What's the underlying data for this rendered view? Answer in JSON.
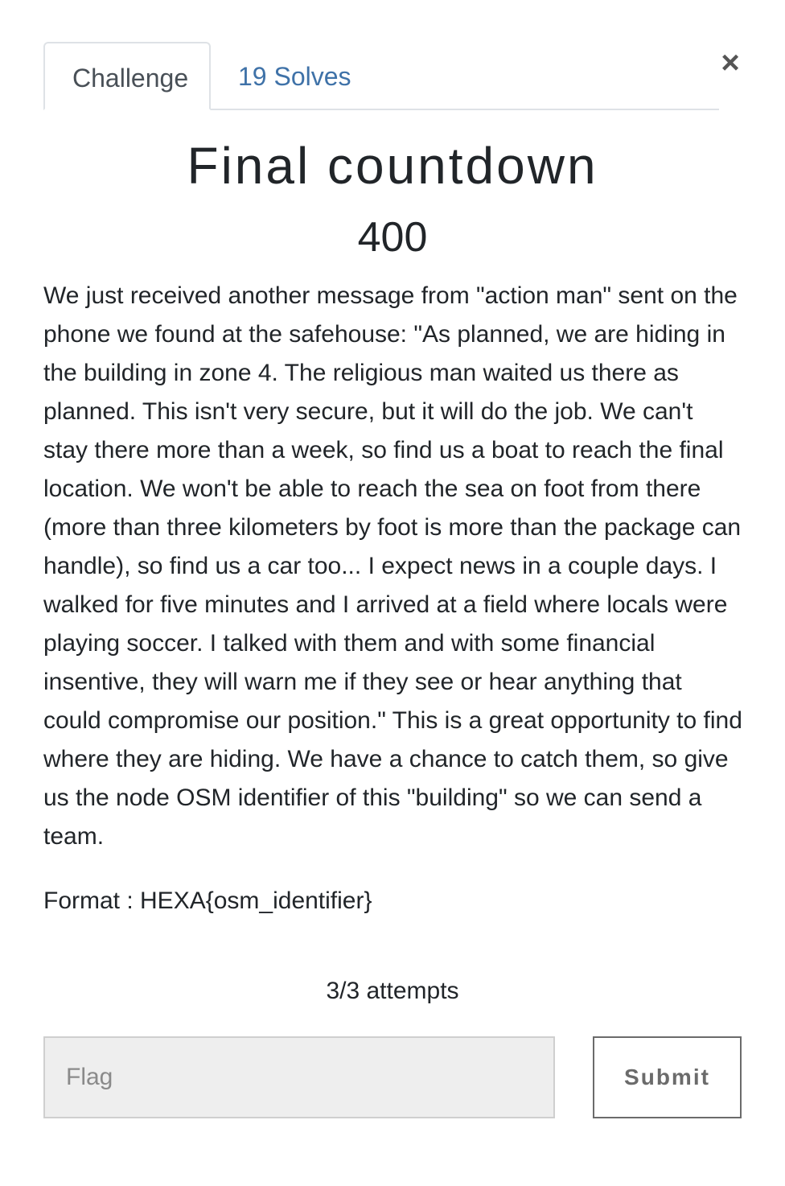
{
  "dialog": {
    "close_symbol": "×",
    "tabs": [
      {
        "label": "Challenge",
        "active": true
      },
      {
        "label": "19 Solves",
        "active": false
      }
    ],
    "challenge": {
      "name": "Final countdown",
      "value": "400",
      "description": "We just received another message from \"action man\" sent on the phone we found at the safehouse: \"As planned, we are hiding in the building in zone 4. The religious man waited us there as planned. This isn't very secure, but it will do the job. We can't stay there more than a week, so find us a boat to reach the final location. We won't be able to reach the sea on foot from there (more than three kilometers by foot is more than the package can handle), so find us a car too... I expect news in a couple days. I walked for five minutes and I arrived at a field where locals were playing soccer. I talked with them and with some financial insentive, they will warn me if they see or hear anything that could compromise our position.\" This is a great opportunity to find where they are hiding. We have a chance to catch them, so give us the node OSM identifier of this \"building\" so we can send a team.",
      "format": "Format : HEXA{osm_identifier}",
      "attempts": "3/3 attempts"
    },
    "flag_input": {
      "placeholder": "Flag",
      "value": ""
    },
    "submit_label": "Submit"
  }
}
